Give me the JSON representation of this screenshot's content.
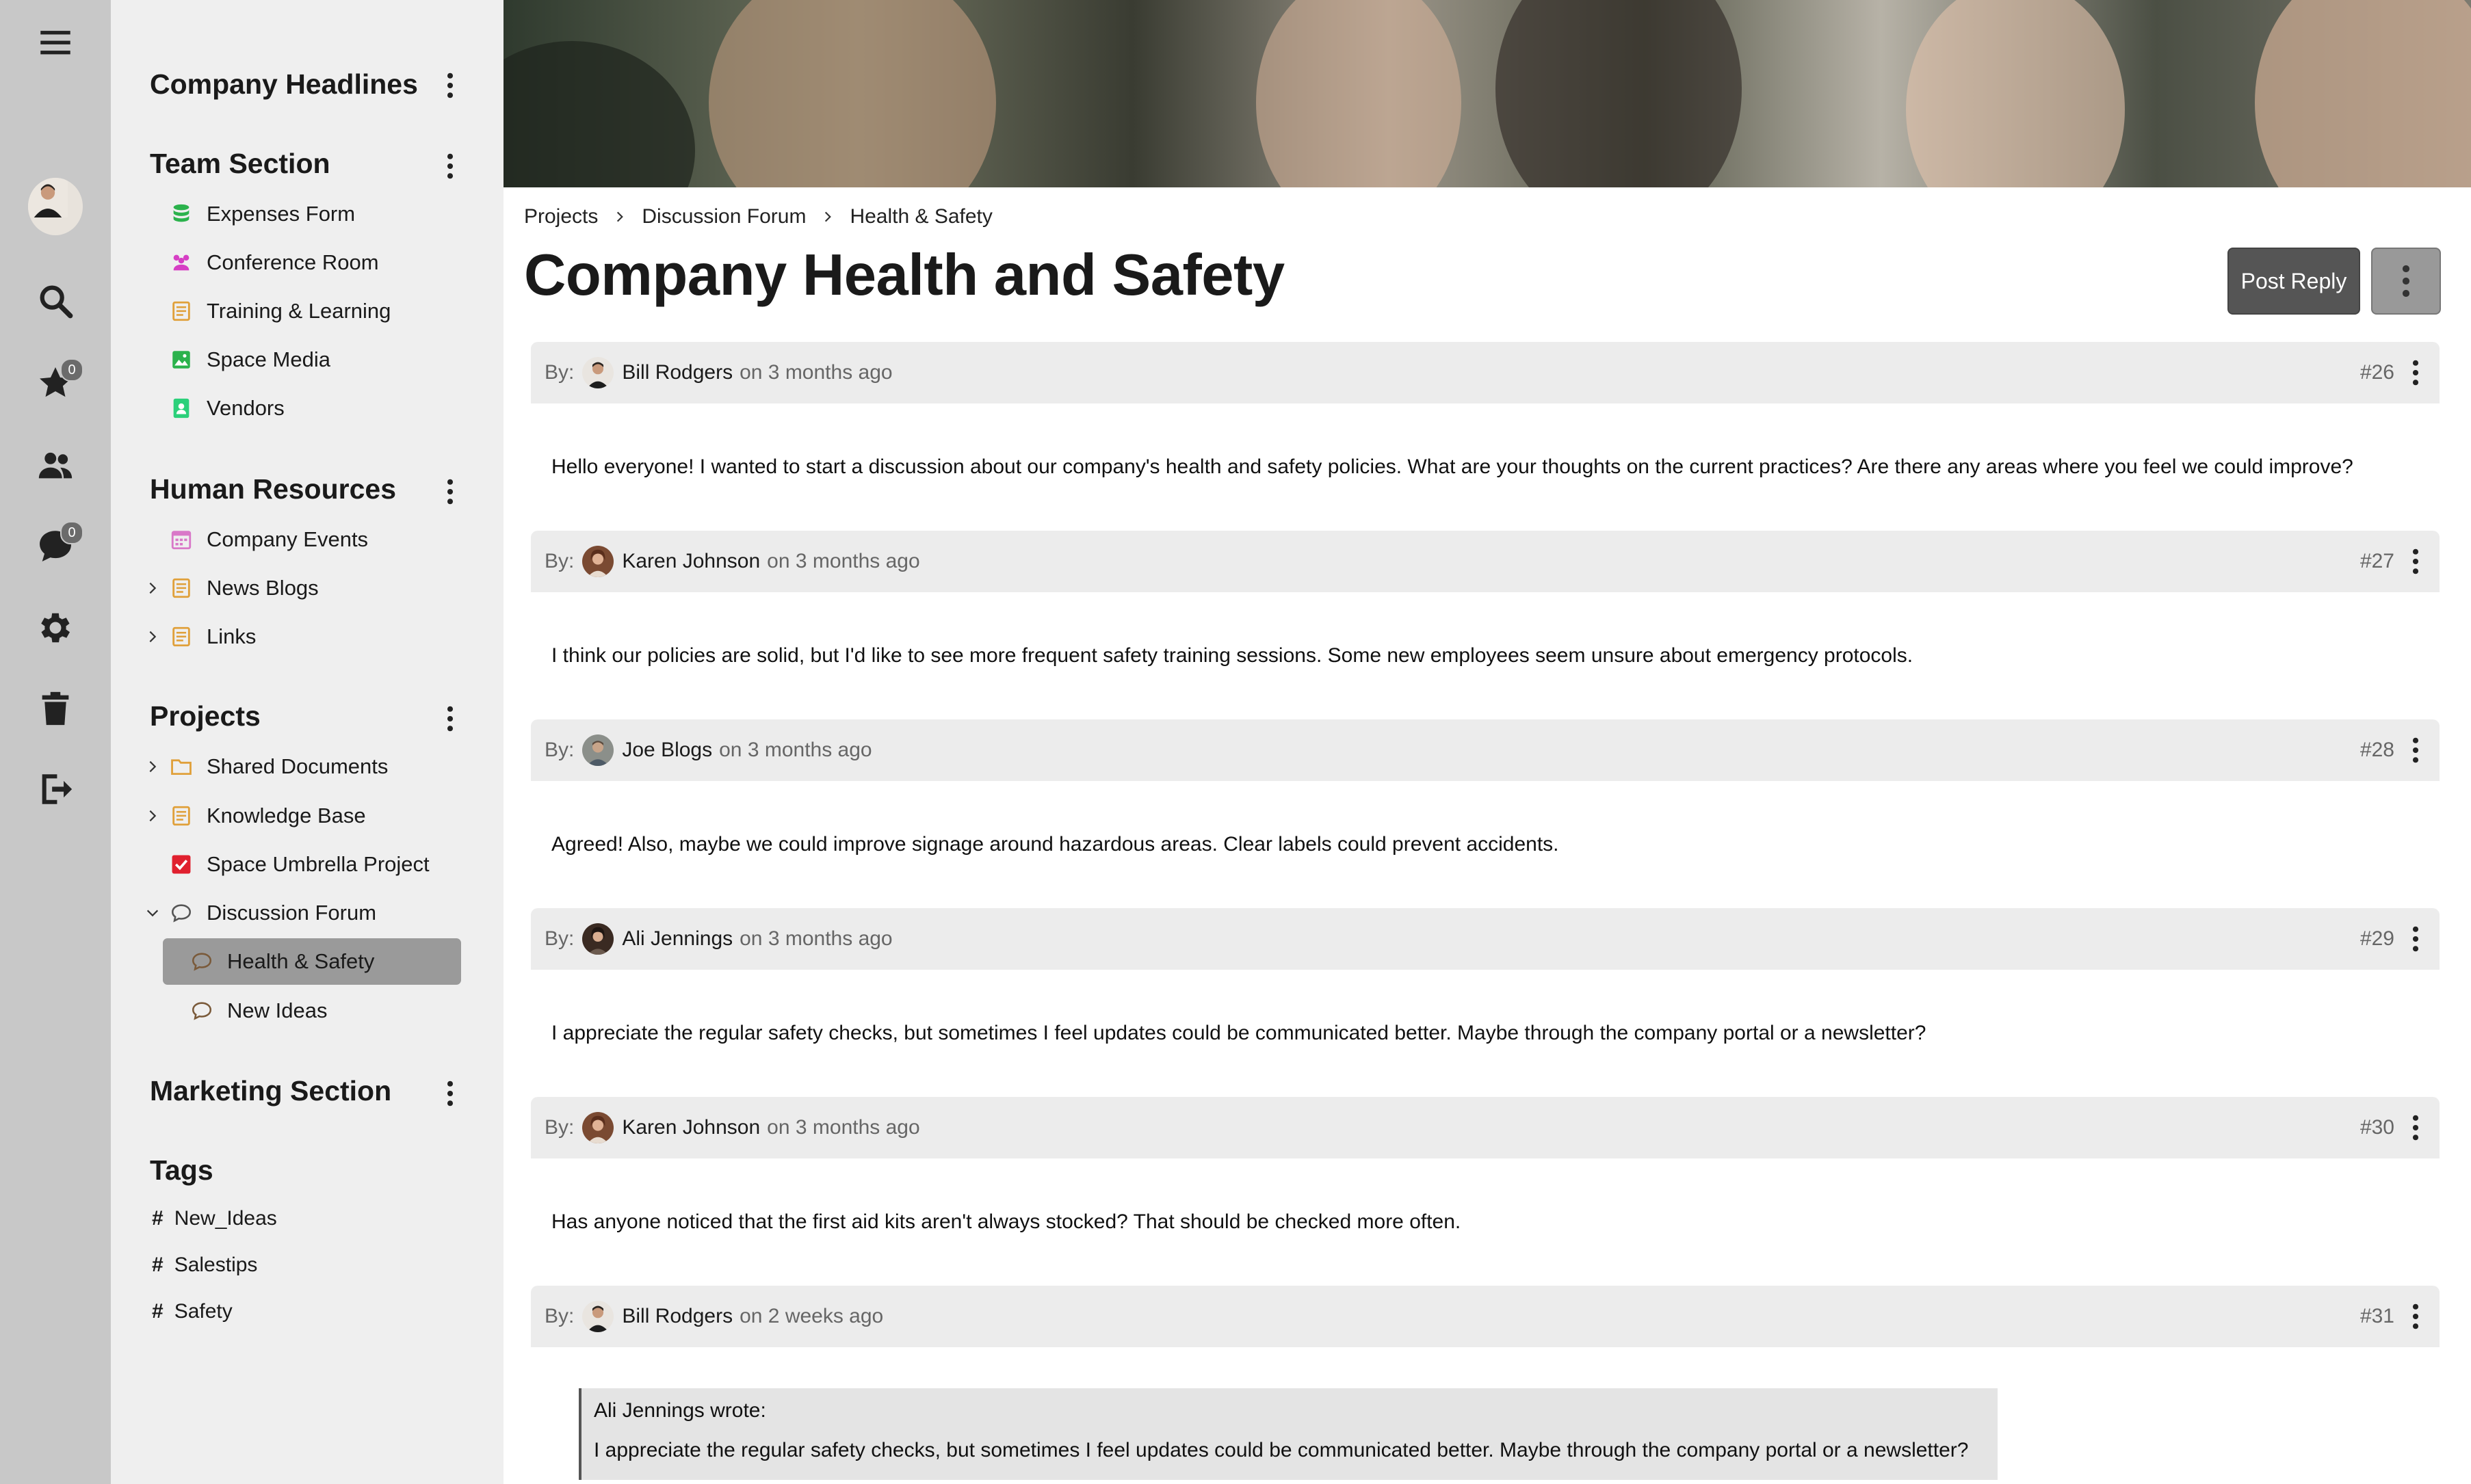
{
  "rail": {
    "menu_icon": "hamburger-menu-icon",
    "favorites_badge": "0",
    "messages_badge": "0"
  },
  "sidebar": {
    "headlines": {
      "title": "Company Headlines"
    },
    "team": {
      "title": "Team Section",
      "items": [
        {
          "label": "Expenses Form",
          "icon": "database-icon",
          "color": "#2bb24c"
        },
        {
          "label": "Conference Room",
          "icon": "group-icon",
          "color": "#d63fc4"
        },
        {
          "label": "Training & Learning",
          "icon": "document-icon",
          "color": "#e0a03a"
        },
        {
          "label": "Space Media",
          "icon": "image-icon",
          "color": "#2bb24c"
        },
        {
          "label": "Vendors",
          "icon": "contact-icon",
          "color": "#2bd07a"
        }
      ]
    },
    "hr": {
      "title": "Human Resources",
      "items": [
        {
          "label": "Company Events",
          "icon": "calendar-icon",
          "color": "#d978c8"
        },
        {
          "label": "News Blogs",
          "icon": "document-icon",
          "color": "#e0a03a"
        },
        {
          "label": "Links",
          "icon": "document-icon",
          "color": "#e0a03a"
        }
      ]
    },
    "projects": {
      "title": "Projects",
      "items": [
        {
          "label": "Shared Documents",
          "icon": "folder-icon",
          "color": "#e0a03a"
        },
        {
          "label": "Knowledge Base",
          "icon": "document-icon",
          "color": "#e0a03a"
        },
        {
          "label": "Space Umbrella Project",
          "icon": "checkbox-icon",
          "color": "#e0202e"
        },
        {
          "label": "Discussion Forum",
          "icon": "speech-bubble-icon",
          "color": "#555555"
        },
        {
          "label": "Health & Safety",
          "icon": "speech-bubble-icon",
          "color": "#7a5a3a"
        },
        {
          "label": "New Ideas",
          "icon": "speech-bubble-icon",
          "color": "#7a5a3a"
        }
      ]
    },
    "marketing": {
      "title": "Marketing Section"
    },
    "tags": {
      "title": "Tags",
      "items": [
        {
          "label": "New_Ideas"
        },
        {
          "label": "Salestips"
        },
        {
          "label": "Safety"
        }
      ]
    }
  },
  "breadcrumb": [
    "Projects",
    "Discussion Forum",
    "Health & Safety"
  ],
  "page": {
    "title": "Company Health and Safety",
    "post_reply_label": "Post Reply"
  },
  "posts": [
    {
      "by": "By:",
      "author": "Bill Rodgers",
      "when": "on 3 months ago",
      "number": "#26",
      "body": "Hello everyone! I wanted to start a discussion about our company's health and safety policies. What are your thoughts on the current practices? Are there any areas where you feel we could improve?"
    },
    {
      "by": "By:",
      "author": "Karen Johnson",
      "when": "on 3 months ago",
      "number": "#27",
      "body": "I think our policies are solid, but I'd like to see more frequent safety training sessions. Some new employees seem unsure about emergency protocols."
    },
    {
      "by": "By:",
      "author": "Joe Blogs",
      "when": "on 3 months ago",
      "number": "#28",
      "body": "Agreed! Also, maybe we could improve signage around hazardous areas. Clear labels could prevent accidents."
    },
    {
      "by": "By:",
      "author": "Ali Jennings",
      "when": "on 3 months ago",
      "number": "#29",
      "body": "I appreciate the regular safety checks, but sometimes I feel updates could be communicated better. Maybe through the company portal or a newsletter?"
    },
    {
      "by": "By:",
      "author": "Karen Johnson",
      "when": "on 3 months ago",
      "number": "#30",
      "body": "Has anyone noticed that the first aid kits aren't always stocked? That should be checked more often."
    },
    {
      "by": "By:",
      "author": "Bill Rodgers",
      "when": "on 2 weeks ago",
      "number": "#31",
      "quote_author": "Ali Jennings wrote:",
      "quote_text": "I appreciate the regular safety checks, but sometimes I feel updates could be communicated better. Maybe through the company portal or a newsletter?"
    }
  ]
}
